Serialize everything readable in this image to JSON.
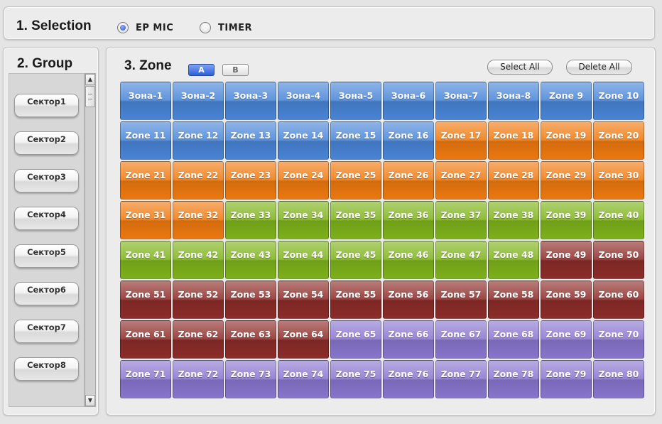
{
  "selection": {
    "title": "1. Selection",
    "options": [
      {
        "label": "EP MIC",
        "checked": true
      },
      {
        "label": "TIMER",
        "checked": false
      }
    ]
  },
  "group": {
    "title": "2. Group",
    "items": [
      "Сектор1",
      "Сектор2",
      "Сектор3",
      "Сектор4",
      "Сектор5",
      "Сектор6",
      "Сектор7",
      "Сектор8"
    ]
  },
  "zone": {
    "title": "3. Zone",
    "tab_a": "A",
    "tab_b": "B",
    "select_all": "Select All",
    "delete_all": "Delete All",
    "colors": {
      "blue": "#4a86d8",
      "orange": "#f07a10",
      "green": "#7fb41c",
      "red": "#8e2d2a",
      "purple": "#8a77d0"
    },
    "zones": [
      {
        "label": "Зона-1",
        "color": "blue"
      },
      {
        "label": "Зона-2",
        "color": "blue"
      },
      {
        "label": "Зона-3",
        "color": "blue"
      },
      {
        "label": "Зона-4",
        "color": "blue"
      },
      {
        "label": "Зона-5",
        "color": "blue"
      },
      {
        "label": "Зона-6",
        "color": "blue"
      },
      {
        "label": "Зона-7",
        "color": "blue"
      },
      {
        "label": "Зона-8",
        "color": "blue"
      },
      {
        "label": "Zone 9",
        "color": "blue"
      },
      {
        "label": "Zone 10",
        "color": "blue"
      },
      {
        "label": "Zone 11",
        "color": "blue"
      },
      {
        "label": "Zone 12",
        "color": "blue"
      },
      {
        "label": "Zone 13",
        "color": "blue"
      },
      {
        "label": "Zone 14",
        "color": "blue"
      },
      {
        "label": "Zone 15",
        "color": "blue"
      },
      {
        "label": "Zone 16",
        "color": "blue"
      },
      {
        "label": "Zone 17",
        "color": "orange"
      },
      {
        "label": "Zone 18",
        "color": "orange"
      },
      {
        "label": "Zone 19",
        "color": "orange"
      },
      {
        "label": "Zone 20",
        "color": "orange"
      },
      {
        "label": "Zone 21",
        "color": "orange"
      },
      {
        "label": "Zone 22",
        "color": "orange"
      },
      {
        "label": "Zone 23",
        "color": "orange"
      },
      {
        "label": "Zone 24",
        "color": "orange"
      },
      {
        "label": "Zone 25",
        "color": "orange"
      },
      {
        "label": "Zone 26",
        "color": "orange"
      },
      {
        "label": "Zone 27",
        "color": "orange"
      },
      {
        "label": "Zone 28",
        "color": "orange"
      },
      {
        "label": "Zone 29",
        "color": "orange"
      },
      {
        "label": "Zone 30",
        "color": "orange"
      },
      {
        "label": "Zone 31",
        "color": "orange"
      },
      {
        "label": "Zone 32",
        "color": "orange"
      },
      {
        "label": "Zone 33",
        "color": "green"
      },
      {
        "label": "Zone 34",
        "color": "green"
      },
      {
        "label": "Zone 35",
        "color": "green"
      },
      {
        "label": "Zone 36",
        "color": "green"
      },
      {
        "label": "Zone 37",
        "color": "green"
      },
      {
        "label": "Zone 38",
        "color": "green"
      },
      {
        "label": "Zone 39",
        "color": "green"
      },
      {
        "label": "Zone 40",
        "color": "green"
      },
      {
        "label": "Zone 41",
        "color": "green"
      },
      {
        "label": "Zone 42",
        "color": "green"
      },
      {
        "label": "Zone 43",
        "color": "green"
      },
      {
        "label": "Zone 44",
        "color": "green"
      },
      {
        "label": "Zone 45",
        "color": "green"
      },
      {
        "label": "Zone 46",
        "color": "green"
      },
      {
        "label": "Zone 47",
        "color": "green"
      },
      {
        "label": "Zone 48",
        "color": "green"
      },
      {
        "label": "Zone 49",
        "color": "red"
      },
      {
        "label": "Zone 50",
        "color": "red"
      },
      {
        "label": "Zone 51",
        "color": "red"
      },
      {
        "label": "Zone 52",
        "color": "red"
      },
      {
        "label": "Zone 53",
        "color": "red"
      },
      {
        "label": "Zone 54",
        "color": "red"
      },
      {
        "label": "Zone 55",
        "color": "red"
      },
      {
        "label": "Zone 56",
        "color": "red"
      },
      {
        "label": "Zone 57",
        "color": "red"
      },
      {
        "label": "Zone 58",
        "color": "red"
      },
      {
        "label": "Zone 59",
        "color": "red"
      },
      {
        "label": "Zone 60",
        "color": "red"
      },
      {
        "label": "Zone 61",
        "color": "red"
      },
      {
        "label": "Zone 62",
        "color": "red"
      },
      {
        "label": "Zone 63",
        "color": "red"
      },
      {
        "label": "Zone 64",
        "color": "red"
      },
      {
        "label": "Zone 65",
        "color": "purple"
      },
      {
        "label": "Zone 66",
        "color": "purple"
      },
      {
        "label": "Zone 67",
        "color": "purple"
      },
      {
        "label": "Zone 68",
        "color": "purple"
      },
      {
        "label": "Zone 69",
        "color": "purple"
      },
      {
        "label": "Zone 70",
        "color": "purple"
      },
      {
        "label": "Zone 71",
        "color": "purple"
      },
      {
        "label": "Zone 72",
        "color": "purple"
      },
      {
        "label": "Zone 73",
        "color": "purple"
      },
      {
        "label": "Zone 74",
        "color": "purple"
      },
      {
        "label": "Zone 75",
        "color": "purple"
      },
      {
        "label": "Zone 76",
        "color": "purple"
      },
      {
        "label": "Zone 77",
        "color": "purple"
      },
      {
        "label": "Zone 78",
        "color": "purple"
      },
      {
        "label": "Zone 79",
        "color": "purple"
      },
      {
        "label": "Zone 80",
        "color": "purple"
      }
    ]
  }
}
